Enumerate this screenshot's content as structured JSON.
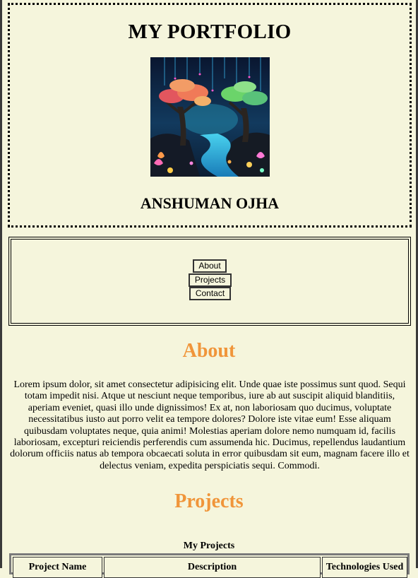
{
  "header": {
    "title": "MY PORTFOLIO",
    "author": "ANSHUMAN OJHA",
    "image_icon": "fantasy-forest-image"
  },
  "nav": {
    "about": "About",
    "projects": "Projects",
    "contact": "Contact"
  },
  "about": {
    "heading": "About",
    "text": "Lorem ipsum dolor, sit amet consectetur adipisicing elit. Unde quae iste possimus sunt quod. Sequi totam impedit nisi. Atque ut nesciunt neque temporibus, iure ab aut suscipit aliquid blanditiis, aperiam eveniet, quasi illo unde dignissimos! Ex at, non laboriosam quo ducimus, voluptate necessitatibus iusto aut porro velit ea tempore dolores? Dolore iste vitae eum! Esse aliquam quibusdam voluptates neque, quia animi! Molestias aperiam dolore nemo numquam id, facilis laboriosam, excepturi reiciendis perferendis cum assumenda hic. Ducimus, repellendus laudantium dolorum officiis natus ab tempora obcaecati soluta in error quibusdam sit eum, magnam facere illo et delectus veniam, expedita perspiciatis sequi. Commodi."
  },
  "projects": {
    "heading": "Projects",
    "caption": "My Projects",
    "columns": [
      "Project Name",
      "Description",
      "Technologies Used"
    ]
  },
  "colors": {
    "background": "#f5f5dc",
    "heading_accent": "#f0953a"
  }
}
